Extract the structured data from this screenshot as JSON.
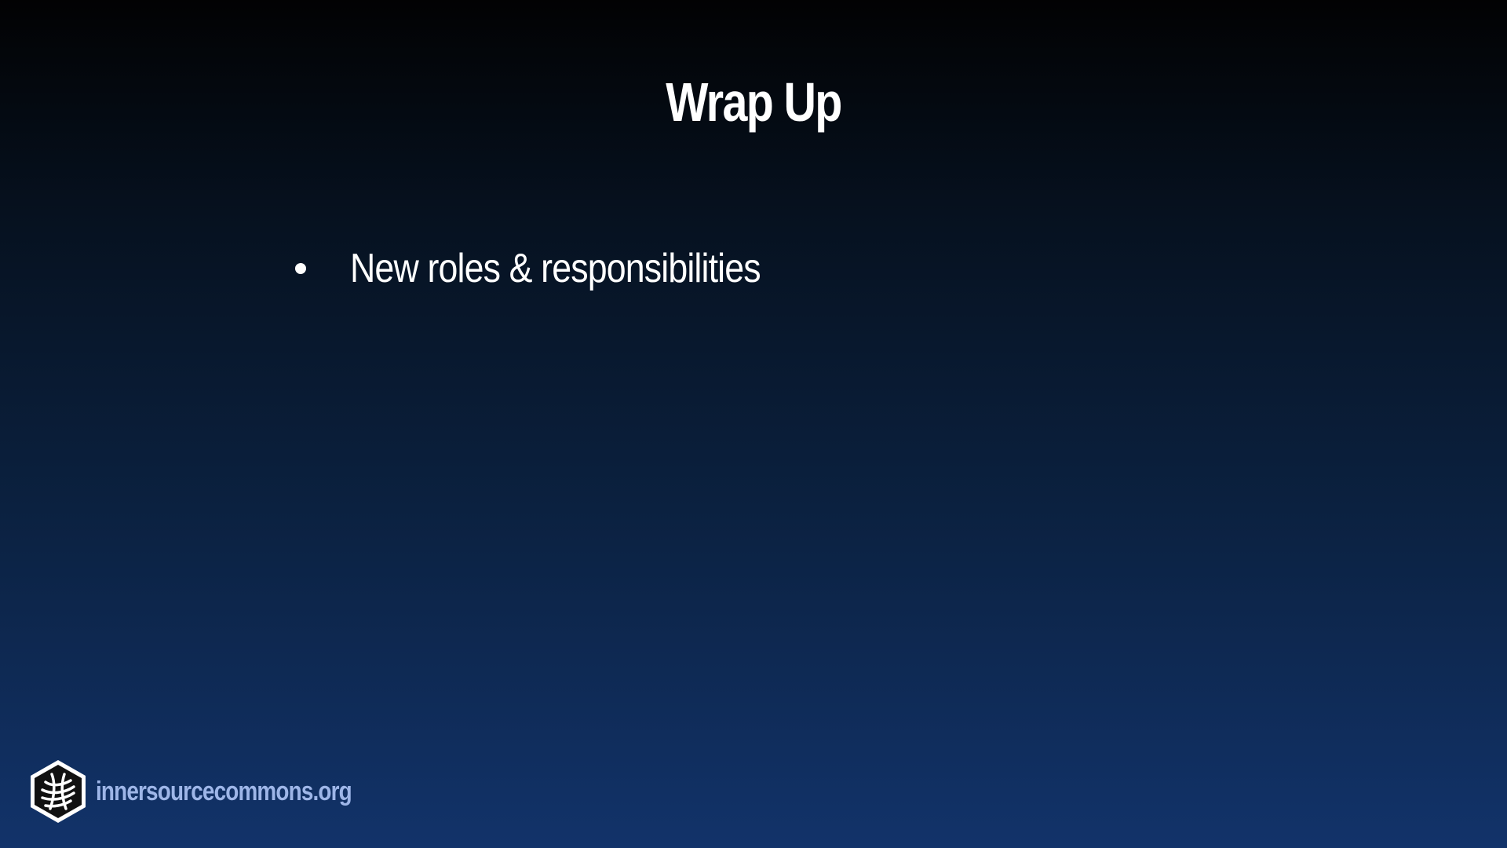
{
  "slide": {
    "title": "Wrap Up",
    "bullets": [
      {
        "text": "New roles & responsibilities"
      }
    ]
  },
  "footer": {
    "logo_text": "innersourcecommons.org",
    "logo_icon": "innersource-commons-hexagon-logo"
  },
  "colors": {
    "background_top": "#020203",
    "background_bottom": "#12336a",
    "text": "#ffffff",
    "logo_text": "#9eb6e8"
  }
}
